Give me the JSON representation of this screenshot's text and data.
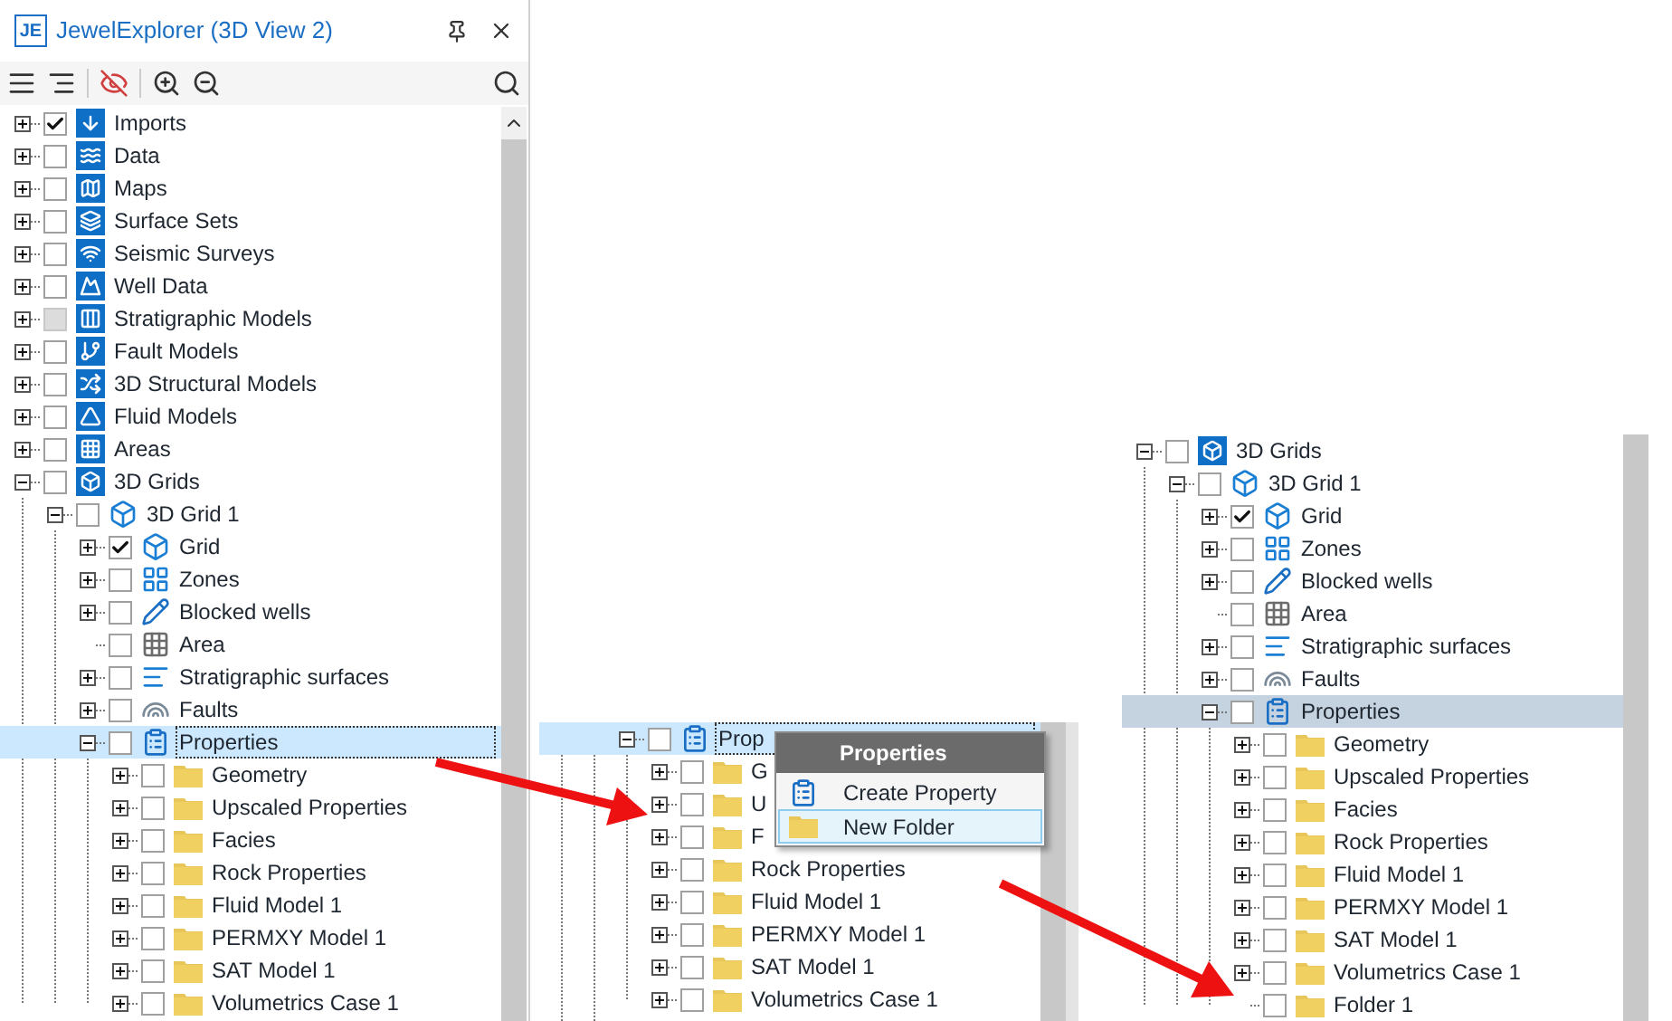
{
  "explorer": {
    "logo": "JE",
    "title": "JewelExplorer (3D View 2)",
    "active": true,
    "tree": [
      {
        "label": "Imports",
        "kind": "imports",
        "checked": true,
        "disabled": false,
        "expanded": false
      },
      {
        "label": "Data",
        "kind": "data",
        "checked": false,
        "disabled": false,
        "expanded": false
      },
      {
        "label": "Maps",
        "kind": "maps",
        "checked": false,
        "disabled": false,
        "expanded": false
      },
      {
        "label": "Surface Sets",
        "kind": "surfaces",
        "checked": false,
        "disabled": false,
        "expanded": false
      },
      {
        "label": "Seismic Surveys",
        "kind": "seismic",
        "checked": false,
        "disabled": false,
        "expanded": false
      },
      {
        "label": "Well Data",
        "kind": "wells",
        "checked": false,
        "disabled": false,
        "expanded": false
      },
      {
        "label": "Stratigraphic Models",
        "kind": "strat",
        "checked": false,
        "disabled": true,
        "expanded": false
      },
      {
        "label": "Fault Models",
        "kind": "fault",
        "checked": false,
        "disabled": false,
        "expanded": false
      },
      {
        "label": "3D Structural Models",
        "kind": "structural",
        "checked": false,
        "disabled": false,
        "expanded": false
      },
      {
        "label": "Fluid Models",
        "kind": "fluid",
        "checked": false,
        "disabled": false,
        "expanded": false
      },
      {
        "label": "Areas",
        "kind": "areas",
        "checked": false,
        "disabled": false,
        "expanded": false
      },
      {
        "label": "3D Grids",
        "kind": "grids",
        "checked": false,
        "disabled": false,
        "expanded": true,
        "children": [
          {
            "label": "3D Grid 1",
            "kind": "gridset",
            "checked": false,
            "expanded": true,
            "children": [
              {
                "label": "Grid",
                "kind": "grid",
                "checked": true,
                "selected": false,
                "expanded": false
              },
              {
                "label": "Zones",
                "kind": "zones",
                "checked": false,
                "selected": false,
                "expanded": false
              },
              {
                "label": "Blocked wells",
                "kind": "blocked",
                "checked": false,
                "selected": false,
                "expanded": false
              },
              {
                "label": "Area",
                "kind": "area",
                "checked": false,
                "selected": false
              },
              {
                "label": "Stratigraphic surfaces",
                "kind": "stratsurf",
                "checked": false,
                "selected": false,
                "expanded": false
              },
              {
                "label": "Faults",
                "kind": "faults",
                "checked": false,
                "selected": false,
                "expanded": false
              },
              {
                "label": "Properties",
                "kind": "properties",
                "checked": false,
                "selected": true,
                "expanded": true,
                "children": [
                  {
                    "label": "Geometry",
                    "kind": "folder",
                    "checked": false,
                    "expanded": false
                  },
                  {
                    "label": "Upscaled Properties",
                    "kind": "folder",
                    "checked": false,
                    "expanded": false
                  },
                  {
                    "label": "Facies",
                    "kind": "folder",
                    "checked": false,
                    "expanded": false
                  },
                  {
                    "label": "Rock Properties",
                    "kind": "folder",
                    "checked": false,
                    "expanded": false
                  },
                  {
                    "label": "Fluid Model 1",
                    "kind": "folder",
                    "checked": false,
                    "expanded": false
                  },
                  {
                    "label": "PERMXY Model 1",
                    "kind": "folder",
                    "checked": false,
                    "expanded": false
                  },
                  {
                    "label": "SAT Model 1",
                    "kind": "folder",
                    "checked": false,
                    "expanded": false
                  },
                  {
                    "label": "Volumetrics Case 1",
                    "kind": "folder",
                    "checked": false,
                    "expanded": false
                  }
                ]
              }
            ]
          }
        ]
      }
    ]
  },
  "menu_step": {
    "active": true,
    "tree": [
      {
        "label": "Prop",
        "kind": "properties",
        "checked": false,
        "selected": true,
        "expanded": true,
        "children": [
          {
            "label": "G",
            "kind": "folder",
            "checked": false,
            "expanded": false
          },
          {
            "label": "U",
            "kind": "folder",
            "checked": false,
            "expanded": false
          },
          {
            "label": "F",
            "kind": "folder",
            "checked": false,
            "expanded": false
          },
          {
            "label": "Rock Properties",
            "kind": "folder",
            "checked": false,
            "expanded": false
          },
          {
            "label": "Fluid Model 1",
            "kind": "folder",
            "checked": false,
            "expanded": false
          },
          {
            "label": "PERMXY Model 1",
            "kind": "folder",
            "checked": false,
            "expanded": false
          },
          {
            "label": "SAT Model 1",
            "kind": "folder",
            "checked": false,
            "expanded": false
          },
          {
            "label": "Volumetrics Case 1",
            "kind": "folder",
            "checked": false,
            "expanded": false
          }
        ]
      }
    ],
    "context_menu": {
      "title": "Properties",
      "items": [
        {
          "label": "Create Property",
          "kind": "clipboard",
          "selected": false
        },
        {
          "label": "New Folder",
          "kind": "folder",
          "selected": true
        }
      ]
    }
  },
  "result_step": {
    "active": false,
    "tree": [
      {
        "label": "3D Grids",
        "kind": "grids",
        "checked": false,
        "expanded": true,
        "children": [
          {
            "label": "3D Grid 1",
            "kind": "gridset",
            "checked": false,
            "expanded": true,
            "children": [
              {
                "label": "Grid",
                "kind": "grid",
                "checked": true,
                "selected": false,
                "expanded": false
              },
              {
                "label": "Zones",
                "kind": "zones",
                "checked": false,
                "selected": false,
                "expanded": false
              },
              {
                "label": "Blocked wells",
                "kind": "blocked",
                "checked": false,
                "selected": false,
                "expanded": false
              },
              {
                "label": "Area",
                "kind": "area",
                "checked": false,
                "selected": false
              },
              {
                "label": "Stratigraphic surfaces",
                "kind": "stratsurf",
                "checked": false,
                "selected": false,
                "expanded": false
              },
              {
                "label": "Faults",
                "kind": "faults",
                "checked": false,
                "selected": false,
                "expanded": false
              },
              {
                "label": "Properties",
                "kind": "properties",
                "checked": false,
                "selected": true,
                "expanded": true,
                "children": [
                  {
                    "label": "Geometry",
                    "kind": "folder",
                    "checked": false,
                    "expanded": false
                  },
                  {
                    "label": "Upscaled Properties",
                    "kind": "folder",
                    "checked": false,
                    "expanded": false
                  },
                  {
                    "label": "Facies",
                    "kind": "folder",
                    "checked": false,
                    "expanded": false
                  },
                  {
                    "label": "Rock Properties",
                    "kind": "folder",
                    "checked": false,
                    "expanded": false
                  },
                  {
                    "label": "Fluid Model 1",
                    "kind": "folder",
                    "checked": false,
                    "expanded": false
                  },
                  {
                    "label": "PERMXY Model 1",
                    "kind": "folder",
                    "checked": false,
                    "expanded": false
                  },
                  {
                    "label": "SAT Model 1",
                    "kind": "folder",
                    "checked": false,
                    "expanded": false
                  },
                  {
                    "label": "Volumetrics Case 1",
                    "kind": "folder",
                    "checked": false,
                    "expanded": false
                  },
                  {
                    "label": "Folder 1",
                    "kind": "folder",
                    "checked": false
                  }
                ]
              }
            ]
          }
        ]
      }
    ]
  }
}
